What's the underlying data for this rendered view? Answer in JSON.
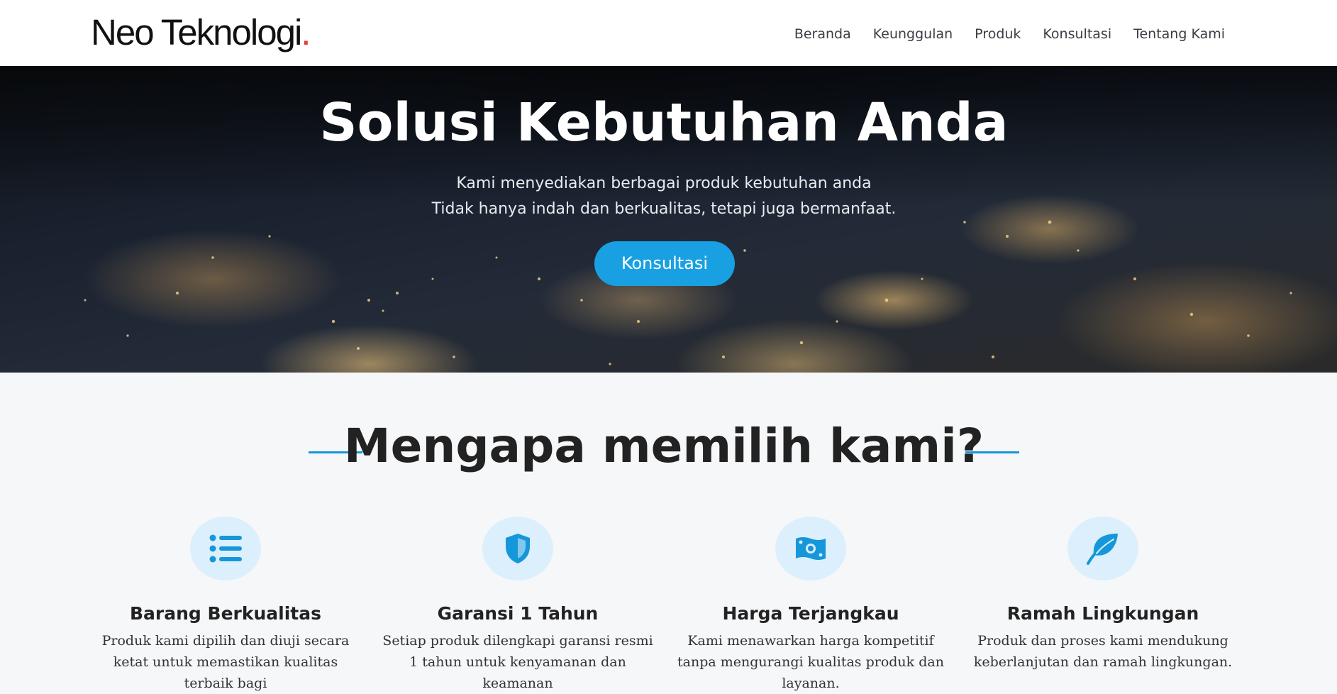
{
  "header": {
    "logo_text": "Neo Teknologi",
    "logo_dot": ".",
    "nav": [
      {
        "label": "Beranda"
      },
      {
        "label": "Keunggulan"
      },
      {
        "label": "Produk"
      },
      {
        "label": "Konsultasi"
      },
      {
        "label": "Tentang Kami"
      }
    ]
  },
  "hero": {
    "title": "Solusi Kebutuhan Anda",
    "subtitle_line1": "Kami menyediakan berbagai produk kebutuhan anda",
    "subtitle_line2": "Tidak hanya indah dan berkualitas, tetapi juga bermanfaat.",
    "cta_label": "Konsultasi"
  },
  "features": {
    "title": "Mengapa memilih kami?",
    "accent_color": "#1597da",
    "items": [
      {
        "icon": "list-icon",
        "title": "Barang Berkualitas",
        "text": "Produk kami dipilih dan diuji secara ketat untuk memastikan kualitas terbaik bagi"
      },
      {
        "icon": "shield-icon",
        "title": "Garansi 1 Tahun",
        "text": "Setiap produk dilengkapi garansi resmi 1 tahun untuk kenyamanan dan keamanan"
      },
      {
        "icon": "money-icon",
        "title": "Harga Terjangkau",
        "text": "Kami menawarkan harga kompetitif tanpa mengurangi kualitas produk dan layanan."
      },
      {
        "icon": "leaf-icon",
        "title": "Ramah Lingkungan",
        "text": "Produk dan proses kami mendukung keberlanjutan dan ramah lingkungan."
      }
    ]
  }
}
